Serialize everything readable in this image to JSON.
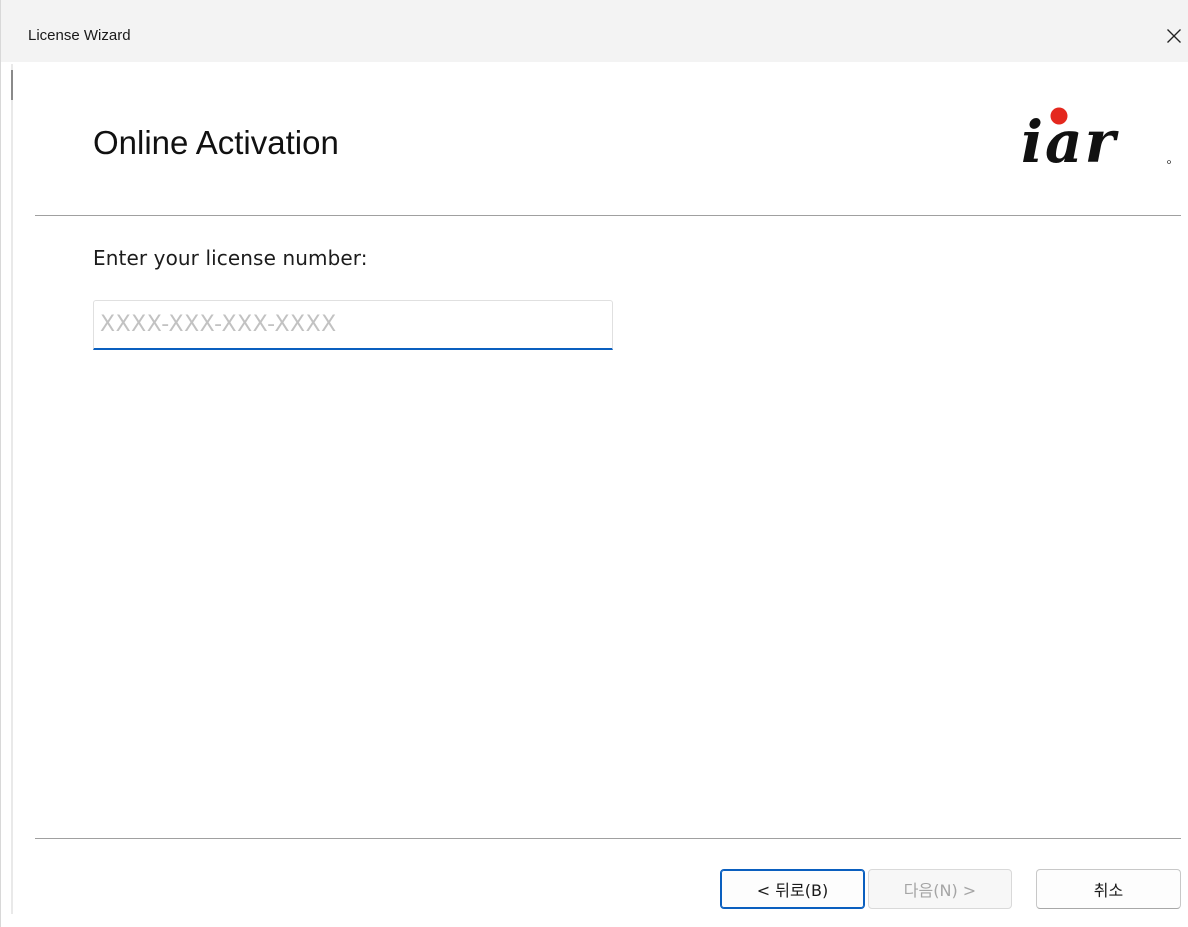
{
  "window": {
    "title": "License Wizard"
  },
  "header": {
    "page_title": "Online Activation",
    "logo_text": "iar"
  },
  "form": {
    "prompt_label": "Enter your license number:",
    "license_input": {
      "value": "",
      "placeholder": "XXXX-XXX-XXX-XXXX"
    }
  },
  "buttons": {
    "back_label": "< 뒤로(B)",
    "next_label": "다음(N) >",
    "cancel_label": "취소"
  },
  "colors": {
    "accent": "#0a5fbf",
    "logo_dot": "#e4281e",
    "logo_ink": "#111111",
    "disabled_text": "#a5a5a5"
  },
  "icons": {
    "close": "close-icon"
  }
}
